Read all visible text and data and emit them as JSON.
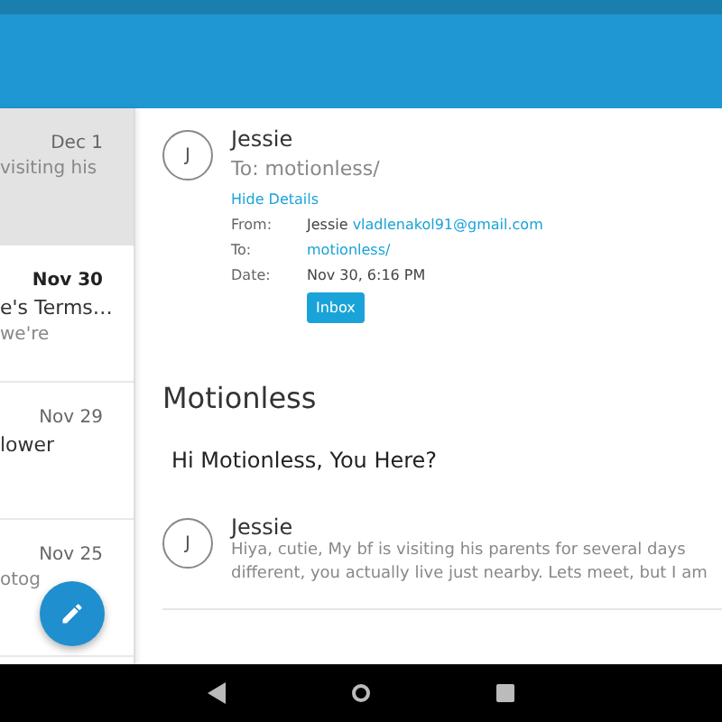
{
  "list": [
    {
      "date": "Dec 1",
      "preview": "visiting his",
      "selected": true,
      "unread": false
    },
    {
      "date": "Nov 30",
      "subject": "e's Terms…",
      "preview": "we're",
      "selected": false,
      "unread": true
    },
    {
      "date": "Nov 29",
      "subject": "lower",
      "selected": false,
      "unread": false
    },
    {
      "date": "Nov 25",
      "preview": "otog",
      "selected": false,
      "unread": false
    }
  ],
  "message": {
    "avatar": "J",
    "sender": "Jessie",
    "to_line": "To: motionless/",
    "hide_details": "Hide Details",
    "details": [
      {
        "label": "From:",
        "name": "Jessie",
        "value": "vladlenakol91@gmail.com",
        "link": true
      },
      {
        "label": "To:",
        "value": "motionless/",
        "link": true
      },
      {
        "label": "Date:",
        "value": "Nov 30, 6:16 PM",
        "link": false
      }
    ],
    "folder": "Inbox"
  },
  "subject": "Motionless",
  "body": "Hi Motionless, You Here?",
  "reply": {
    "avatar": "J",
    "sender": "Jessie",
    "lines": [
      "Hiya, cutie, My bf is visiting his parents for several days",
      "different, you actually live just nearby. Lets meet, but I am"
    ]
  }
}
